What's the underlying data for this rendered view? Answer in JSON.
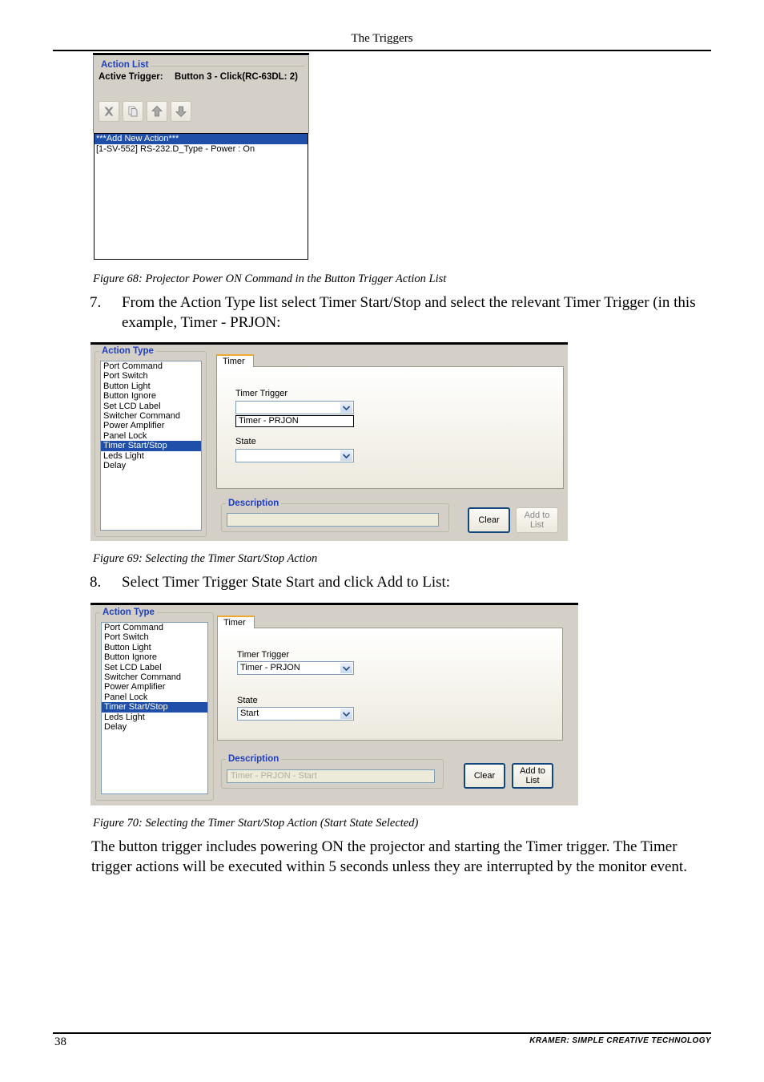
{
  "page": {
    "header_title": "The Triggers",
    "page_number": "38",
    "footer_brand": "KRAMER:  SIMPLE CREATIVE TECHNOLOGY"
  },
  "colors": {
    "group_label": "#1f3fbf",
    "selection": "#1f4fa8",
    "tab_accent": "#f0a830",
    "dialog_face": "#d4d0c8",
    "focus_border": "#12477e"
  },
  "captions": {
    "fig68": "Figure 68: Projector Power ON Command in the Button Trigger Action List",
    "fig69": "Figure 69: Selecting the Timer Start/Stop Action",
    "fig70": "Figure 70: Selecting the Timer Start/Stop Action (Start State Selected)"
  },
  "steps": {
    "step7_num": "7.",
    "step7_text": "From the Action Type list select Timer Start/Stop and select the relevant Timer Trigger (in this example, Timer - PRJON:",
    "step8_num": "8.",
    "step8_text": "Select Timer Trigger State Start and click Add to List:"
  },
  "closing_paragraph": "The button trigger includes powering ON the projector and starting the Timer trigger. The Timer trigger actions will be executed within 5 seconds unless they are interrupted by the monitor event.",
  "fig68": {
    "group_label": "Action List",
    "active_trigger_label": "Active Trigger:",
    "active_trigger_value": "Button 3 - Click(RC-63DL: 2)",
    "toolbar": [
      {
        "name": "delete-icon",
        "glyph": "x"
      },
      {
        "name": "copy-icon",
        "glyph": "copy"
      },
      {
        "name": "move-up-icon",
        "glyph": "up"
      },
      {
        "name": "move-down-icon",
        "glyph": "down"
      }
    ],
    "list_items": [
      {
        "label": "***Add New Action***",
        "selected": true
      },
      {
        "label": "[1-SV-552] RS-232.D_Type - Power : On",
        "selected": false
      }
    ]
  },
  "fig69": {
    "action_type": {
      "group_label": "Action Type",
      "items": [
        {
          "label": "Port Command",
          "selected": false
        },
        {
          "label": "Port Switch",
          "selected": false
        },
        {
          "label": "Button Light",
          "selected": false
        },
        {
          "label": "Button Ignore",
          "selected": false
        },
        {
          "label": "Set LCD Label",
          "selected": false
        },
        {
          "label": "Switcher Command",
          "selected": false
        },
        {
          "label": "Power Amplifier",
          "selected": false
        },
        {
          "label": "Panel Lock",
          "selected": false
        },
        {
          "label": "Timer Start/Stop",
          "selected": true
        },
        {
          "label": "Leds Light",
          "selected": false
        },
        {
          "label": "Delay",
          "selected": false
        }
      ]
    },
    "tab_label": "Timer",
    "timer_trigger_label": "Timer Trigger",
    "timer_trigger_value": "",
    "timer_trigger_options": [
      "Timer - PRJON"
    ],
    "state_label": "State",
    "state_value": "",
    "description_label": "Description",
    "description_value": "",
    "clear_button": "Clear",
    "add_to_list_button": "Add to\nList"
  },
  "fig70": {
    "action_type": {
      "group_label": "Action Type",
      "items": [
        {
          "label": "Port Command",
          "selected": false
        },
        {
          "label": "Port Switch",
          "selected": false
        },
        {
          "label": "Button Light",
          "selected": false
        },
        {
          "label": "Button Ignore",
          "selected": false
        },
        {
          "label": "Set LCD Label",
          "selected": false
        },
        {
          "label": "Switcher Command",
          "selected": false
        },
        {
          "label": "Power Amplifier",
          "selected": false
        },
        {
          "label": "Panel Lock",
          "selected": false
        },
        {
          "label": "Timer Start/Stop",
          "selected": true
        },
        {
          "label": "Leds Light",
          "selected": false
        },
        {
          "label": "Delay",
          "selected": false
        }
      ]
    },
    "tab_label": "Timer",
    "timer_trigger_label": "Timer Trigger",
    "timer_trigger_value": "Timer - PRJON",
    "state_label": "State",
    "state_value": "Start",
    "description_label": "Description",
    "description_value": "Timer - PRJON - Start",
    "clear_button": "Clear",
    "add_to_list_button": "Add to\nList"
  }
}
